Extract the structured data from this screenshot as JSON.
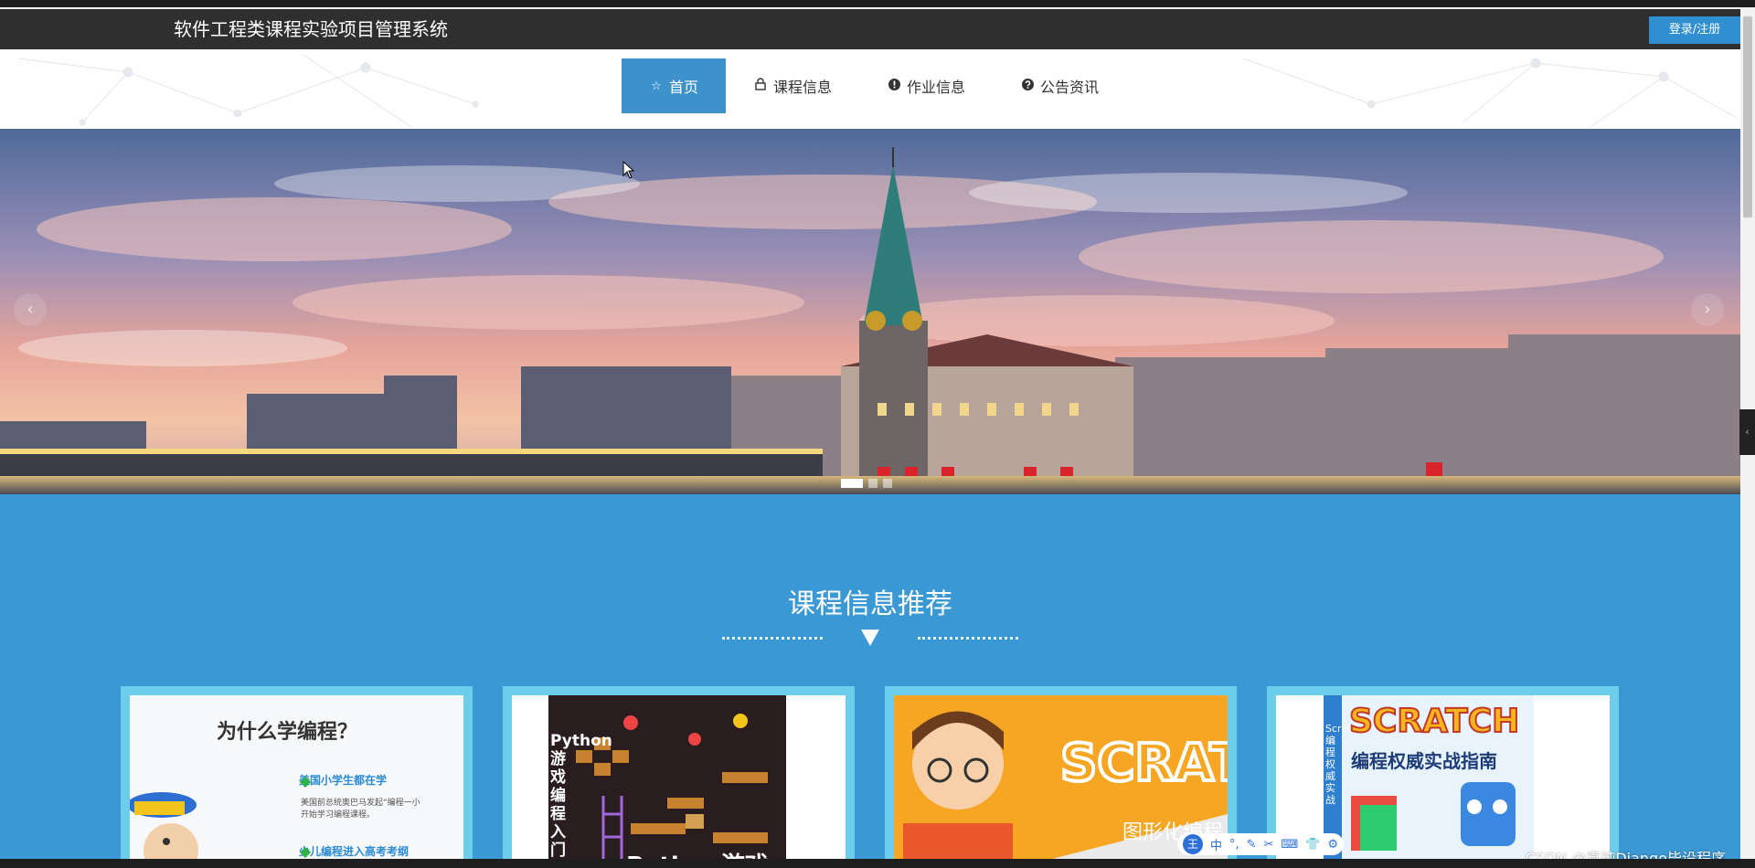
{
  "header": {
    "site_title": "软件工程类课程实验项目管理系统",
    "login_label": "登录/注册"
  },
  "nav": {
    "items": [
      {
        "label": "首页",
        "icon": "star-outline-icon",
        "active": true
      },
      {
        "label": "课程信息",
        "icon": "lock-icon",
        "active": false
      },
      {
        "label": "作业信息",
        "icon": "exclamation-circle-icon",
        "active": false
      },
      {
        "label": "公告资讯",
        "icon": "question-circle-icon",
        "active": false
      }
    ]
  },
  "carousel": {
    "prev_glyph": "‹",
    "next_glyph": "›",
    "slide_count": 3,
    "active_slide": 1
  },
  "recommend": {
    "title": "课程信息推荐",
    "cards": [
      {
        "heading": "为什么学编程？",
        "bullet_1": "美国小学生都在学",
        "sub_1a": "美国前总统奥巴马发起“编程一小",
        "sub_1b": "开始学习编程课程。",
        "bullet_2": "少儿编程进入高考考纲"
      },
      {
        "side_text": "Python游戏编程入门",
        "bottom_text": "Python游戏"
      },
      {
        "logo_text": "SCRAT",
        "sub_text": "图形化编程"
      },
      {
        "logo_text": "SCRATCH",
        "subtitle": "编程权威实战指南",
        "spine_text": "Scratch编程权威实战"
      }
    ]
  },
  "ime": {
    "logo": "王",
    "mode": "中"
  },
  "watermark": "CSDN @真纯Django毕设程序",
  "colors": {
    "header_bg": "#2f2f2f",
    "accent": "#3d92cc",
    "section_bg": "#3a98d4",
    "card_border": "#6fcdec"
  }
}
